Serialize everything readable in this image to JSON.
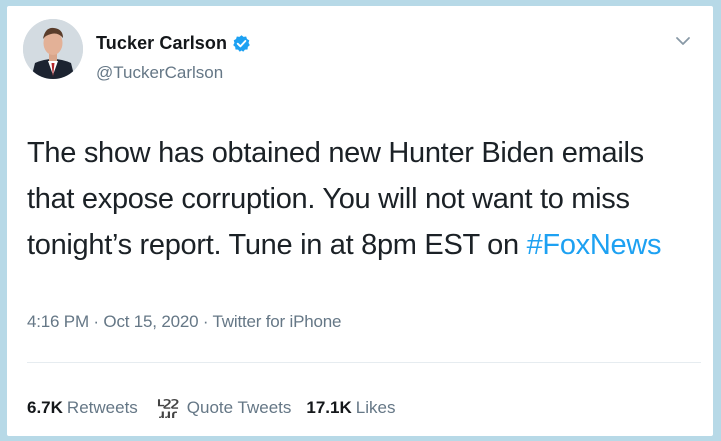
{
  "tweet": {
    "author": {
      "display_name": "Tucker Carlson",
      "handle": "@TuckerCarlson",
      "verified": true
    },
    "text_before_hashtag": "The show has obtained new Hunter Biden emails that expose corruption. You will not want to miss tonight’s report. Tune in at 8pm EST on ",
    "hashtag": "#FoxNews",
    "meta": "4:16 PM · Oct 15, 2020 · Twitter for iPhone",
    "stats": {
      "retweets_count": "6.7K",
      "retweets_label": "Retweets",
      "quote_count_top": "ւշշ",
      "quote_count_bottom": "ɹɹɾ",
      "quote_label": "Quote Tweets",
      "likes_count": "17.1K",
      "likes_label": "Likes"
    }
  },
  "icons": {
    "verified": "verified-badge-icon",
    "menu": "chevron-down-icon"
  },
  "colors": {
    "background": "#b7d9e7",
    "card": "#ffffff",
    "accent": "#1da1f2",
    "text": "#14171a",
    "muted": "#657786"
  }
}
